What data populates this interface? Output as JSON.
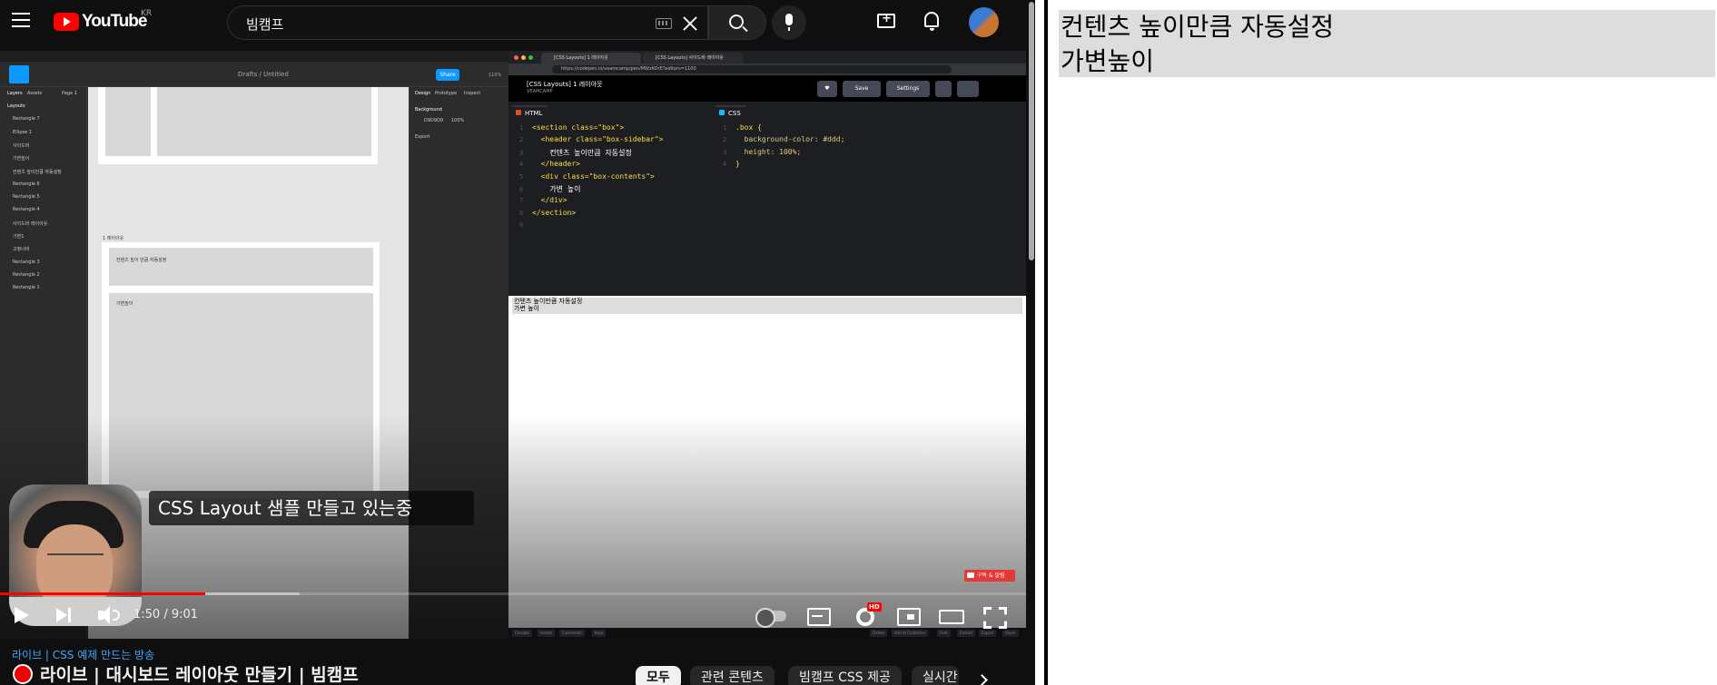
{
  "header": {
    "logo_text": "YouTube",
    "country_code": "KR",
    "search_value": "빔캠프"
  },
  "figma": {
    "file_breadcrumb": "Drafts / Untitled",
    "share_label": "Share",
    "zoom": "110%",
    "layers_title": "Layers",
    "assets_tab": "Assets",
    "page_label": "Page 1",
    "layers": [
      "Layouts",
      "Rectangle 7",
      "Ellipse 1",
      "사이드바",
      "가변높이",
      "컨텐츠 높이만큼 자동설정",
      "Rectangle 6",
      "Rectangle 5",
      "Rectangle 4",
      "사이드바 레이아웃",
      "가변1",
      "고정너비",
      "Rectangle 3",
      "Rectangle 2",
      "Rectangle 1"
    ],
    "canvas_label": "1 레이아웃",
    "canvas_block_1": "컨텐츠 높이 만큼 자동설정",
    "canvas_block_2": "가변높이",
    "props_tabs": [
      "Design",
      "Prototype",
      "Inspect"
    ],
    "background_label": "Background",
    "background_value": "D9D9D9",
    "background_opacity": "100%",
    "export_label": "Export"
  },
  "codepen": {
    "tabs": [
      "[CSS Layouts] 1 레이아웃",
      "[CSS Layouts] 사이드바 레이아웃"
    ],
    "url": "https://codepen.io/veamcamp/pen/MWzKOrE?editors=1100",
    "pen_title": "[CSS Layouts] 1 레이아웃",
    "pen_author": "VEAMCAMP",
    "save_label": "Save",
    "settings_label": "Settings",
    "html_tab": "HTML",
    "css_tab": "CSS",
    "html_lines": [
      {
        "n": "1",
        "text": "<section class=\"box\">"
      },
      {
        "n": "2",
        "text": "  <header class=\"box-sidebar\">"
      },
      {
        "n": "3",
        "text": "    컨텐츠 높이만큼 자동설정"
      },
      {
        "n": "4",
        "text": "  </header>"
      },
      {
        "n": "5",
        "text": "  <div class=\"box-contents\">"
      },
      {
        "n": "6",
        "text": "    가변 높이"
      },
      {
        "n": "7",
        "text": "  </div>"
      },
      {
        "n": "8",
        "text": "</section>"
      },
      {
        "n": "9",
        "text": ""
      }
    ],
    "css_lines": [
      {
        "n": "1",
        "text": ".box {"
      },
      {
        "n": "2",
        "text": "  background-color: #ddd;"
      },
      {
        "n": "3",
        "text": "  height: 100%;"
      },
      {
        "n": "4",
        "text": "}"
      }
    ],
    "preview_lines": [
      "컨텐츠 높이만큼 자동설정",
      "가변 높이"
    ],
    "footer_buttons": [
      "Console",
      "Assets",
      "Comments",
      "Keys"
    ],
    "footer_right": [
      "Delete",
      "Add to Collection",
      "Fork",
      "Embed",
      "Export",
      "Share"
    ]
  },
  "player": {
    "caption": "CSS Layout 샘플 만들고 있는중",
    "subscribe_badge": "구독 & 알림",
    "time_text": "1:50 / 9:01",
    "progress_played_fraction": 0.2,
    "progress_buffered_fraction": 0.292,
    "hd_label": "HD"
  },
  "video": {
    "channel_link": "라이브 | CSS 예제 만드는 방송",
    "title": "라이브 | 대시보드 레이아웃 만들기 | 빔캠프"
  },
  "chips": [
    "모두",
    "관련 콘텐츠",
    "빔캠프 CSS 제공",
    "실시간"
  ],
  "result_pane": {
    "line1": "컨텐츠 높이만큼 자동설정",
    "line2": "가변높이"
  },
  "colors": {
    "youtube_red": "#ff0000",
    "dark_bg": "#0f0f0f",
    "result_box": "#dddddd"
  }
}
